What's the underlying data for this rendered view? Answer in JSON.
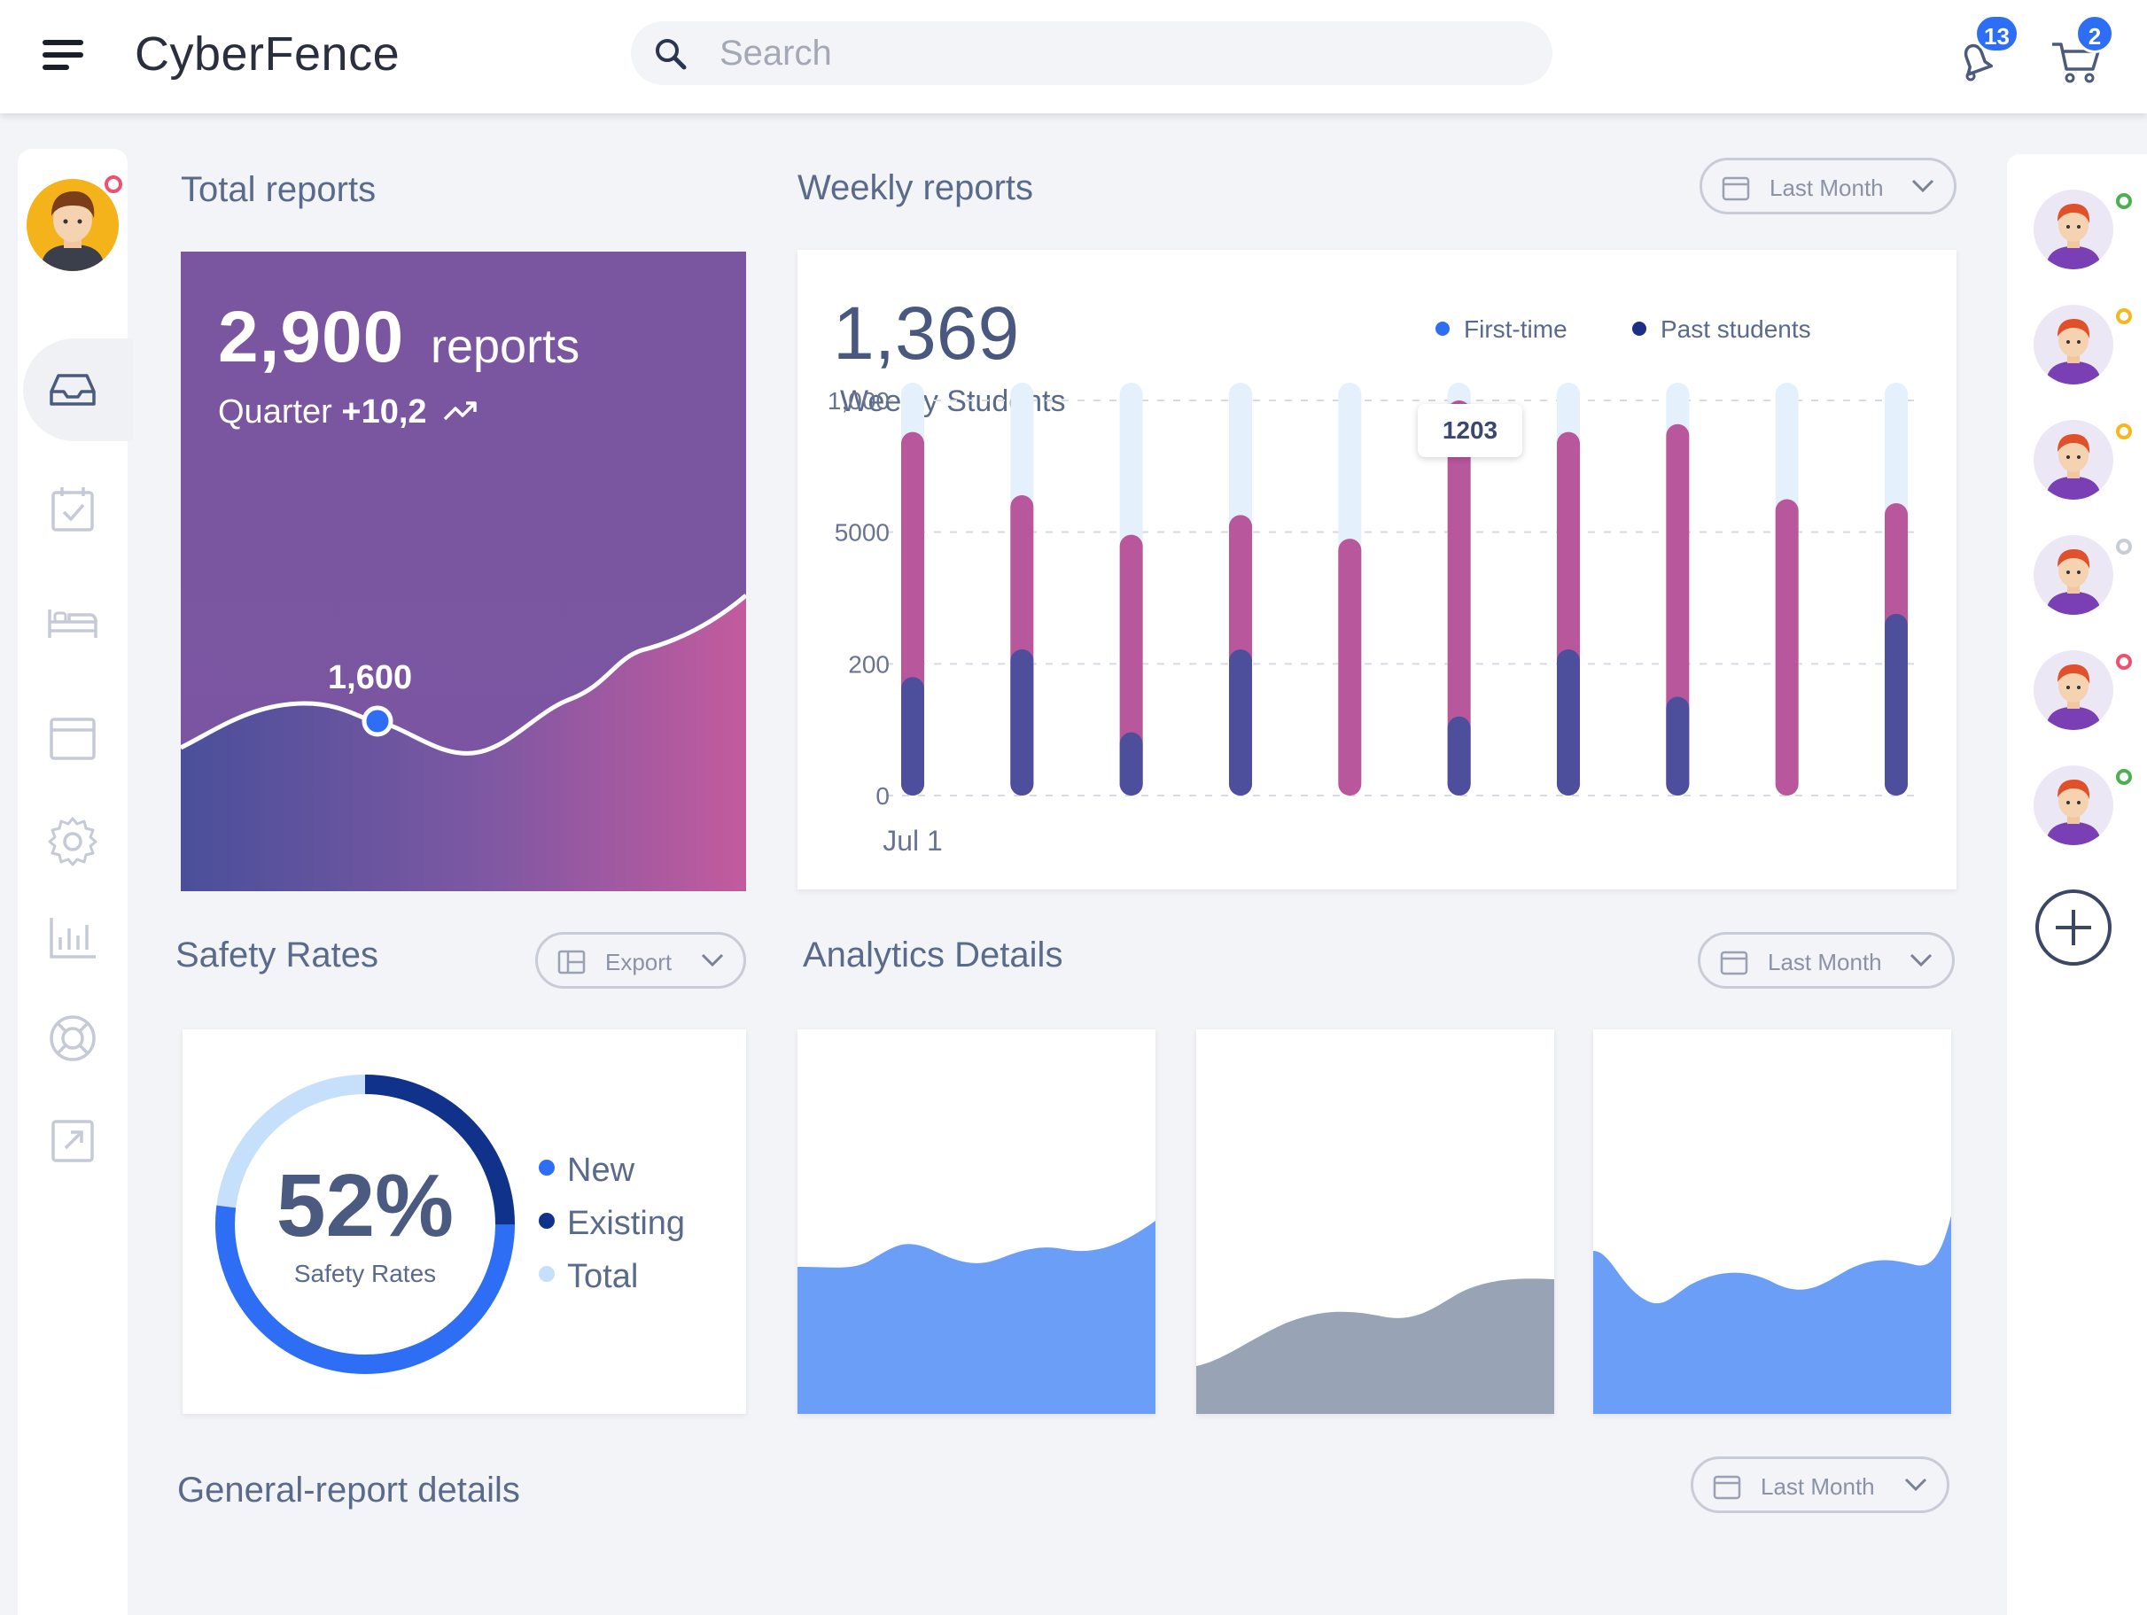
{
  "header": {
    "app_title": "CyberFence",
    "search_placeholder": "Search",
    "notifications_count": "13",
    "cart_count": "2"
  },
  "total_reports": {
    "section_title": "Total reports",
    "value": "2,900",
    "unit": "reports",
    "quarter_label": "Quarter",
    "quarter_change": "+10,2",
    "peak_label": "1,600"
  },
  "weekly_reports": {
    "section_title": "Weekly reports",
    "range": "Last Month",
    "value": "1,369",
    "subtitle": "Weekly Students",
    "tooltip": "1203",
    "legend": [
      {
        "label": "First-time",
        "color": "#2d6ef5"
      },
      {
        "label": "Past students",
        "color": "#1c2f85"
      }
    ]
  },
  "chart_data": {
    "type": "bar",
    "categories": [
      "Jul 1",
      "",
      "",
      "",
      "",
      "",
      "",
      "",
      "",
      ""
    ],
    "y_tick_labels": [
      "1,000",
      "5000",
      "200",
      "0"
    ],
    "ylim": [
      0,
      1000
    ],
    "series": [
      {
        "name": "First-time",
        "color": "#b9579c",
        "values": [
          920,
          760,
          660,
          710,
          650,
          1000,
          920,
          940,
          750,
          740
        ]
      },
      {
        "name": "Past students",
        "color": "#4d4f9d",
        "values": [
          300,
          370,
          160,
          370,
          0,
          200,
          370,
          250,
          0,
          460
        ]
      }
    ],
    "track_color": "#e4f0fc",
    "grid": true
  },
  "safety_rates": {
    "section_title": "Safety Rates",
    "export_label": "Export",
    "percent": "52%",
    "percent_value": 52,
    "subtitle": "Safety Rates",
    "legend": [
      {
        "label": "New",
        "color": "#2d6ef5"
      },
      {
        "label": "Existing",
        "color": "#10328a"
      },
      {
        "label": "Total",
        "color": "#c6e0fb"
      }
    ]
  },
  "analytics": {
    "section_title": "Analytics Details",
    "range": "Last Month",
    "cards": [
      {
        "name": "analytics-card-1",
        "color": "#6b9ff7"
      },
      {
        "name": "analytics-card-2",
        "color": "#98a3b5"
      },
      {
        "name": "analytics-card-3",
        "color": "#6b9ff7"
      }
    ]
  },
  "general_report": {
    "section_title": "General-report details",
    "range": "Last Month"
  },
  "users": [
    {
      "status": "online",
      "color": "#4caf50"
    },
    {
      "status": "away",
      "color": "#f5b71e"
    },
    {
      "status": "away",
      "color": "#f5b71e"
    },
    {
      "status": "offline",
      "color": "#c8ccd6"
    },
    {
      "status": "busy",
      "color": "#f0506e"
    },
    {
      "status": "online",
      "color": "#4caf50"
    }
  ],
  "sidebar": {
    "icons": [
      "inbox-icon",
      "calendar-check-icon",
      "bed-icon",
      "browser-window-icon",
      "gear-icon",
      "bar-chart-icon",
      "lifebuoy-icon",
      "external-link-icon"
    ]
  }
}
